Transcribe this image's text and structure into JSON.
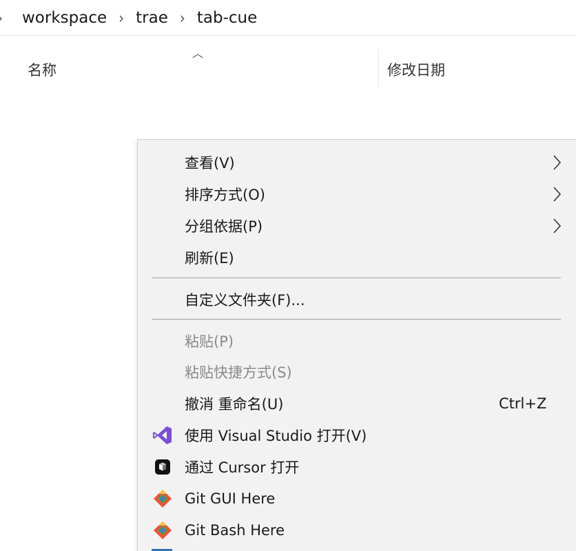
{
  "breadcrumb": {
    "items": [
      "workspace",
      "trae",
      "tab-cue"
    ]
  },
  "columns": {
    "name": "名称",
    "date_modified": "修改日期"
  },
  "context_menu": {
    "items": [
      {
        "label": "查看(V)",
        "has_submenu": true,
        "enabled": true
      },
      {
        "label": "排序方式(O)",
        "has_submenu": true,
        "enabled": true
      },
      {
        "label": "分组依据(P)",
        "has_submenu": true,
        "enabled": true
      },
      {
        "label": "刷新(E)",
        "has_submenu": false,
        "enabled": true
      },
      {
        "label": "自定义文件夹(F)...",
        "has_submenu": false,
        "enabled": true
      },
      {
        "label": "粘贴(P)",
        "has_submenu": false,
        "enabled": false
      },
      {
        "label": "粘贴快捷方式(S)",
        "has_submenu": false,
        "enabled": false
      },
      {
        "label": "撤消 重命名(U)",
        "shortcut": "Ctrl+Z",
        "enabled": true
      },
      {
        "label": "使用 Visual Studio 打开(V)",
        "icon": "visual-studio-icon",
        "enabled": true
      },
      {
        "label": "通过 Cursor 打开",
        "icon": "cursor-icon",
        "enabled": true
      },
      {
        "label": "Git GUI Here",
        "icon": "git-gui-icon",
        "enabled": true
      },
      {
        "label": "Git Bash Here",
        "icon": "git-bash-icon",
        "enabled": true
      }
    ]
  },
  "colors": {
    "menu_background": "#f2f2f2",
    "disabled_text": "#8a8a8a",
    "visual_studio": "#7b4fd6",
    "git_orange": "#f05133"
  }
}
